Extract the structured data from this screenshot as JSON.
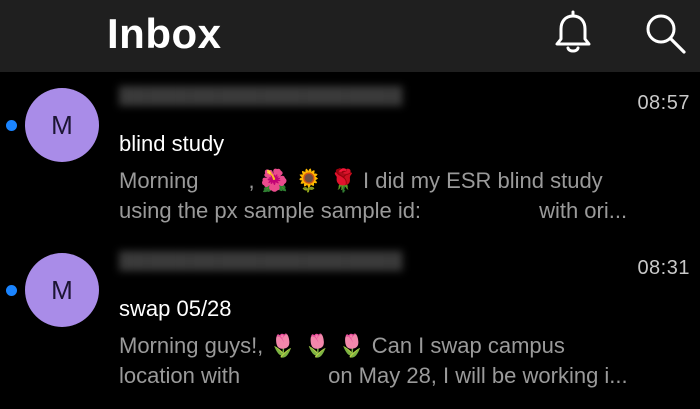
{
  "header": {
    "title": "Inbox",
    "icons": [
      "bell-icon",
      "search-icon"
    ]
  },
  "messages": [
    {
      "avatar_letter": "M",
      "unread": true,
      "time": "08:57",
      "subject": "blind study",
      "preview_line1_a": "Morning",
      "preview_line1_b": ",",
      "preview_line1_emojis": "🌺 🌻 🌹",
      "preview_line1_c": " I did my ESR blind study",
      "preview_line2_a": "using the px sample sample id:",
      "preview_line2_b": "with ori..."
    },
    {
      "avatar_letter": "M",
      "unread": true,
      "time": "08:31",
      "subject": "swap 05/28",
      "preview_line1_a": "Morning guys!,",
      "preview_line1_emojis": "🌷 🌷 🌷",
      "preview_line1_c": " Can I swap campus",
      "preview_line2_a": "location with",
      "preview_line2_b": "on May 28, I will be working i..."
    }
  ]
}
